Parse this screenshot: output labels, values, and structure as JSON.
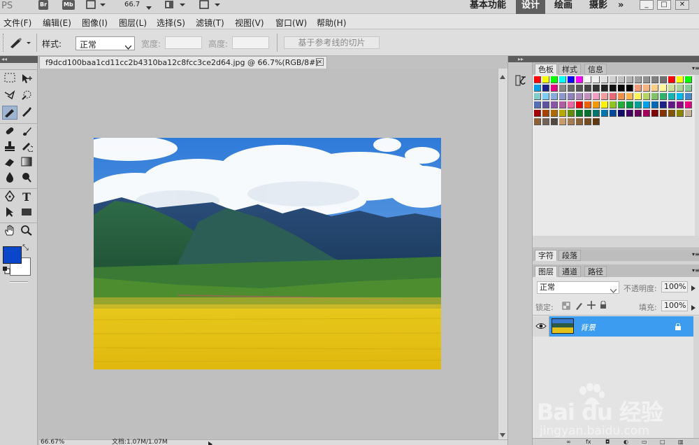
{
  "appbar": {
    "ps": "PS",
    "br": "Br",
    "mb": "Mb",
    "zoom": "66.7",
    "workspaces": [
      "基本功能",
      "设计",
      "绘画",
      "摄影"
    ],
    "more": "»",
    "active_workspace": "设计"
  },
  "menus": [
    "文件(F)",
    "编辑(E)",
    "图像(I)",
    "图层(L)",
    "选择(S)",
    "滤镜(T)",
    "视图(V)",
    "窗口(W)",
    "帮助(H)"
  ],
  "options": {
    "style_label": "样式:",
    "style_value": "正常",
    "width_label": "宽度:",
    "height_label": "高度:",
    "slice_button": "基于参考线的切片"
  },
  "document": {
    "tab_title": "f9dcd100baa1cd11cc2b4310ba12c8fcc3ce2d64.jpg @ 66.7%(RGB/8#)",
    "status_zoom": "66.67%",
    "status_doc": "文档:1.07M/1.07M"
  },
  "colors": {
    "foreground": "#0a46c9",
    "background": "#ffffff",
    "selection": "#3c9cf0"
  },
  "swatches_panel": {
    "tabs": [
      "色板",
      "样式",
      "信息"
    ]
  },
  "char_panel": {
    "tabs": [
      "字符",
      "段落"
    ]
  },
  "layers_panel": {
    "tabs": [
      "图层",
      "通道",
      "路径"
    ],
    "blend_mode": "正常",
    "opacity_label": "不透明度:",
    "opacity_value": "100%",
    "lock_label": "锁定:",
    "fill_label": "填充:",
    "fill_value": "100%",
    "layers": [
      {
        "name": "背景",
        "locked": true,
        "visible": true
      }
    ]
  },
  "watermark": {
    "brand": "Bai du 经验",
    "url": "jingyan.baidu.com"
  }
}
